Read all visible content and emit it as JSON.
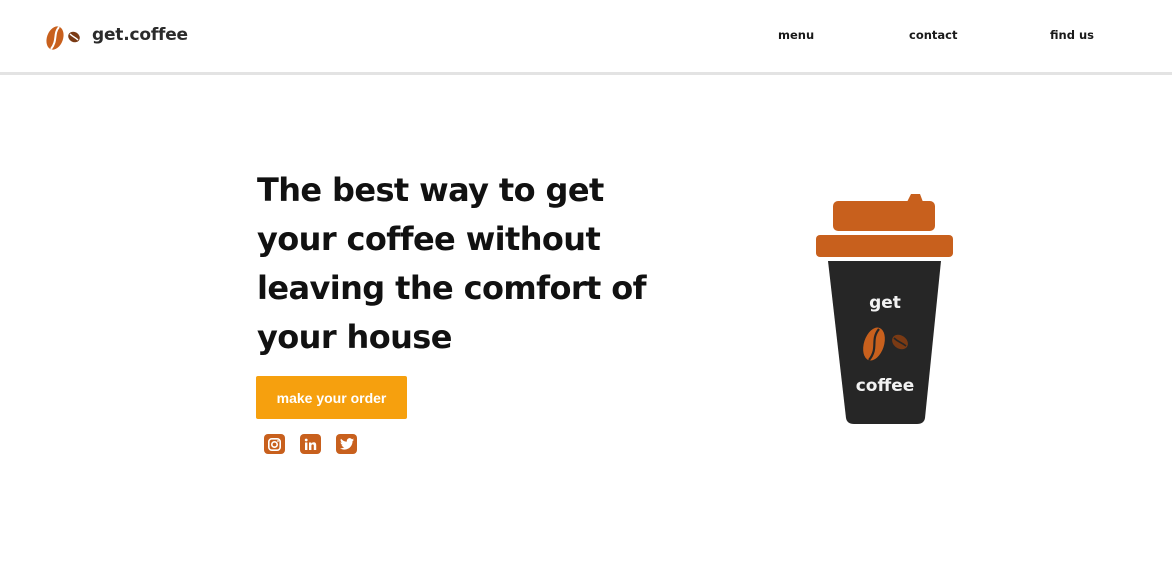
{
  "header": {
    "logo_text": "get.coffee",
    "nav": {
      "menu": "menu",
      "contact": "contact",
      "find_us": "find us"
    }
  },
  "hero": {
    "title": "The best way to get your coffee without leaving the comfort of your house",
    "cta_label": "make your order",
    "socials": [
      "instagram-icon",
      "linkedin-icon",
      "twitter-icon"
    ]
  },
  "illustration": {
    "cup_text_top": "get",
    "cup_text_bottom": "coffee"
  },
  "colors": {
    "accent": "#f6a00e",
    "brand_brown": "#c8601d",
    "cup_body": "#262626",
    "divider": "#e3e3e3"
  }
}
